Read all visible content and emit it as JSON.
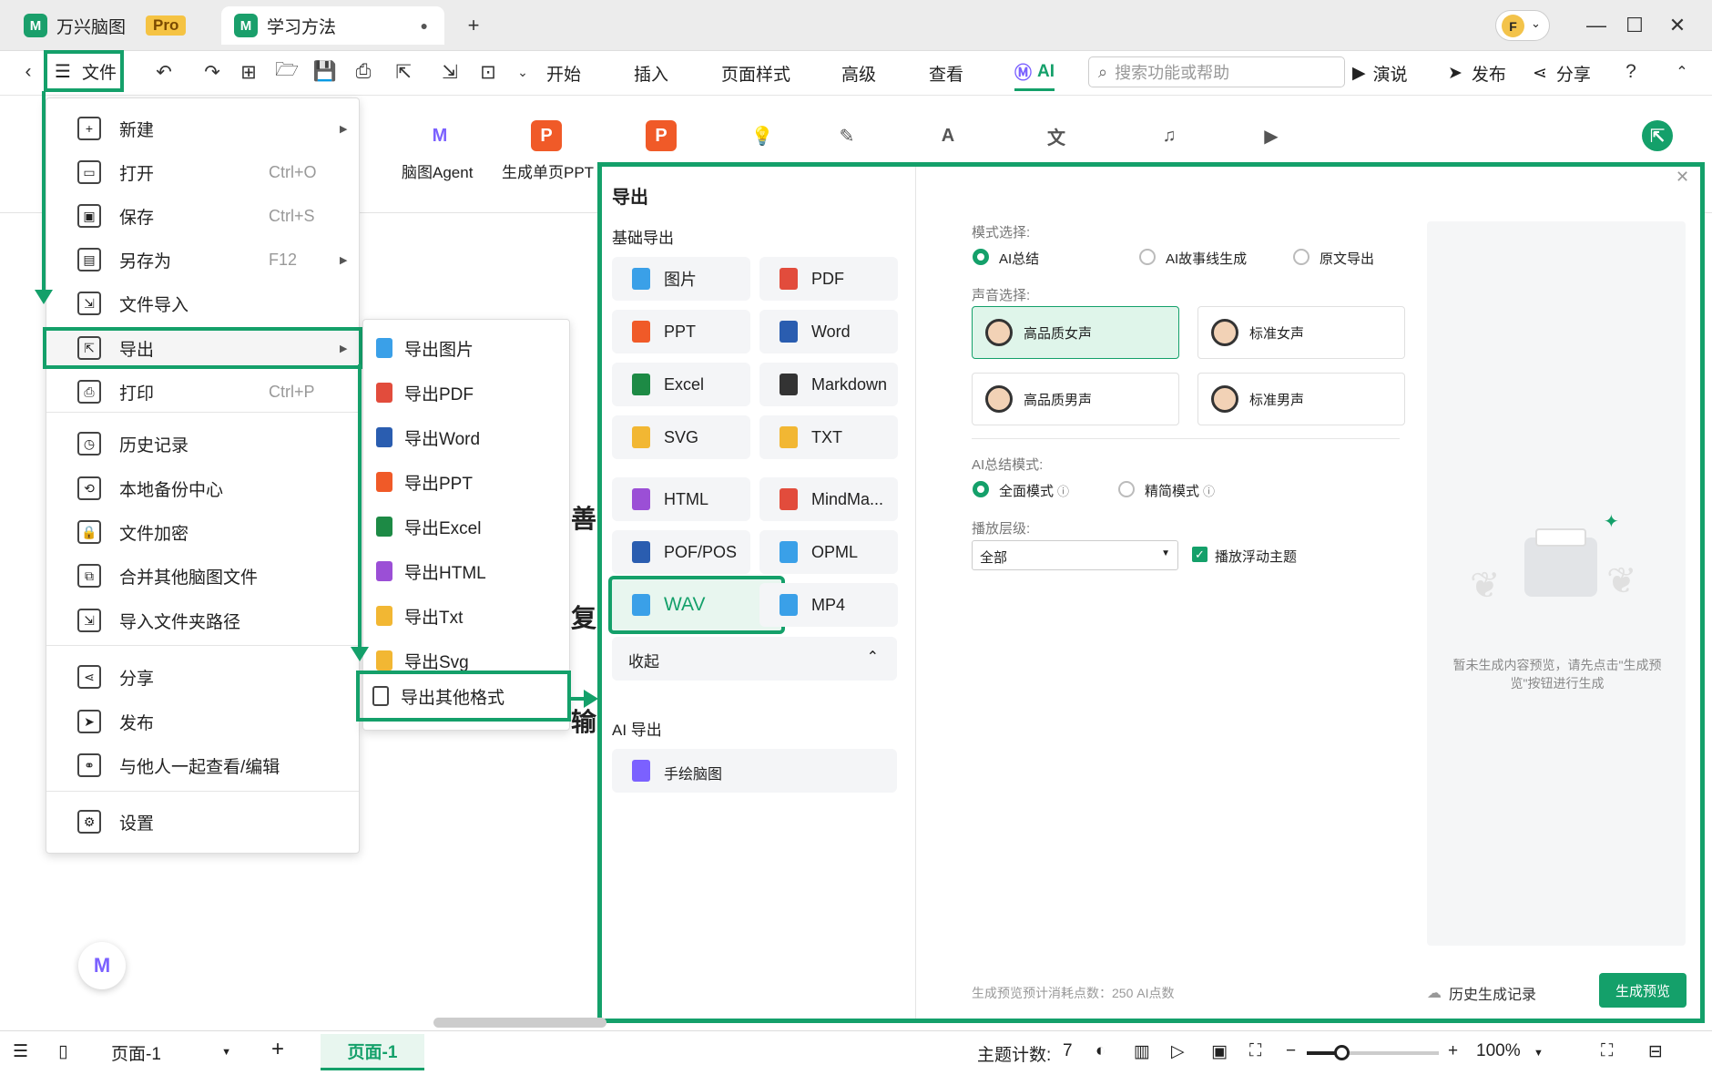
{
  "window": {
    "app_tab": "万兴脑图",
    "pro": "Pro",
    "doc_tab": "学习方法",
    "new_tab": "+",
    "minimize": "—",
    "maximize": "☐",
    "close": "✕",
    "avatar": "F"
  },
  "toolbar": {
    "file": "文件",
    "tabs": [
      "开始",
      "插入",
      "页面样式",
      "高级",
      "查看"
    ],
    "ai": "AI",
    "search_placeholder": "搜索功能或帮助",
    "present": "演说",
    "publish": "发布",
    "share": "分享"
  },
  "ribbon": {
    "agent": "脑图Agent",
    "ppt": "生成单页PPT"
  },
  "file_menu": [
    {
      "label": "新建",
      "shortcut": "",
      "arrow": true
    },
    {
      "label": "打开",
      "shortcut": "Ctrl+O"
    },
    {
      "label": "保存",
      "shortcut": "Ctrl+S"
    },
    {
      "label": "另存为",
      "shortcut": "F12",
      "arrow": true
    },
    {
      "label": "文件导入",
      "shortcut": ""
    },
    {
      "label": "导出",
      "shortcut": "",
      "arrow": true
    },
    {
      "label": "打印",
      "shortcut": "Ctrl+P"
    },
    {
      "label": "历史记录"
    },
    {
      "label": "本地备份中心"
    },
    {
      "label": "文件加密"
    },
    {
      "label": "合并其他脑图文件"
    },
    {
      "label": "导入文件夹路径"
    },
    {
      "label": "分享"
    },
    {
      "label": "发布"
    },
    {
      "label": "与他人一起查看/编辑"
    },
    {
      "label": "设置"
    }
  ],
  "export_submenu": [
    "导出图片",
    "导出PDF",
    "导出Word",
    "导出PPT",
    "导出Excel",
    "导出HTML",
    "导出Txt",
    "导出Svg",
    "导出其他格式"
  ],
  "canvas_text": [
    "善",
    "复",
    "输"
  ],
  "dialog": {
    "title": "导出",
    "basic": "基础导出",
    "formats": [
      "图片",
      "PDF",
      "PPT",
      "Word",
      "Excel",
      "Markdown",
      "SVG",
      "TXT",
      "HTML",
      "MindMa...",
      "POF/POS",
      "OPML",
      "WAV",
      "MP4"
    ],
    "collapse": "收起",
    "ai_export": "AI 导出",
    "handdrawn": "手绘脑图",
    "mode_label": "模式选择:",
    "modes": [
      "AI总结",
      "AI故事线生成",
      "原文导出"
    ],
    "voice_label": "声音选择:",
    "voices": [
      "高品质女声",
      "标准女声",
      "高品质男声",
      "标准男声"
    ],
    "summary_label": "AI总结模式:",
    "summary_modes": [
      "全面模式",
      "精简模式"
    ],
    "level_label": "播放层级:",
    "level_value": "全部",
    "float_theme": "播放浮动主题",
    "preview_hint": "暂未生成内容预览，请先点击\"生成预览\"按钮进行生成",
    "cost": "生成预览预计消耗点数：250 AI点数",
    "history": "历史生成记录",
    "generate": "生成预览"
  },
  "statusbar": {
    "page_select": "页面-1",
    "page_tab": "页面-1",
    "topic_count_label": "主题计数:",
    "topic_count": "7",
    "zoom": "100%"
  },
  "colors": {
    "accent": "#14a06a"
  }
}
